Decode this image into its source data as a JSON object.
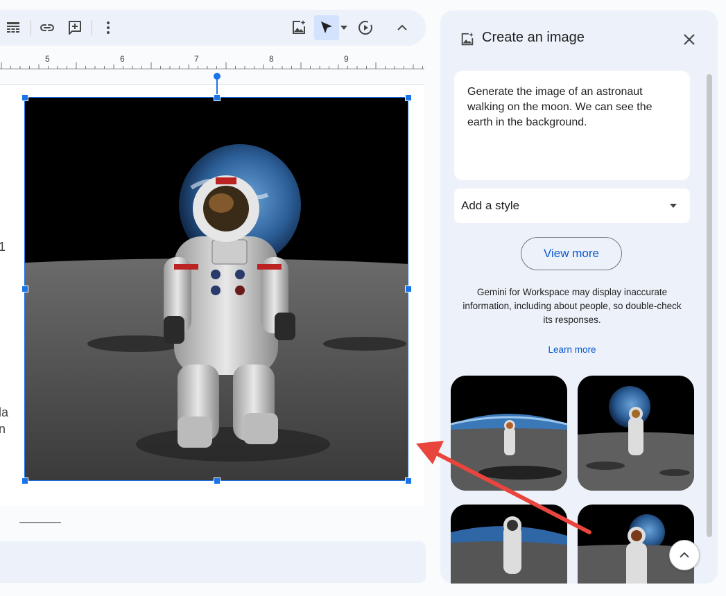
{
  "toolbar": {
    "icons": [
      "table-options-icon",
      "link-icon",
      "add-comment-icon",
      "more-vert-icon",
      "image-sparkle-icon",
      "pointer-icon",
      "pointer-dropdown-icon",
      "play-circle-icon",
      "chevron-up-icon"
    ]
  },
  "ruler": {
    "marks": [
      "5",
      "6",
      "7",
      "8",
      "9"
    ]
  },
  "document": {
    "stray_text": [
      "1",
      "la",
      "n"
    ]
  },
  "side_panel": {
    "title": "Create an image",
    "prompt": "Generate the image of an astronaut walking on the moon. We can see the earth in the background.",
    "style_placeholder": "Add a style",
    "view_more_label": "View more",
    "disclaimer": "Gemini for Workspace may display inaccurate information, including about people, so double-check its responses.",
    "learn_more_label": "Learn more",
    "thumbnails_count": 4
  },
  "colors": {
    "accent": "#1a73e8",
    "link": "#0b57d0",
    "panel_bg": "#edf2fa",
    "annotation_arrow": "#e8453c"
  }
}
